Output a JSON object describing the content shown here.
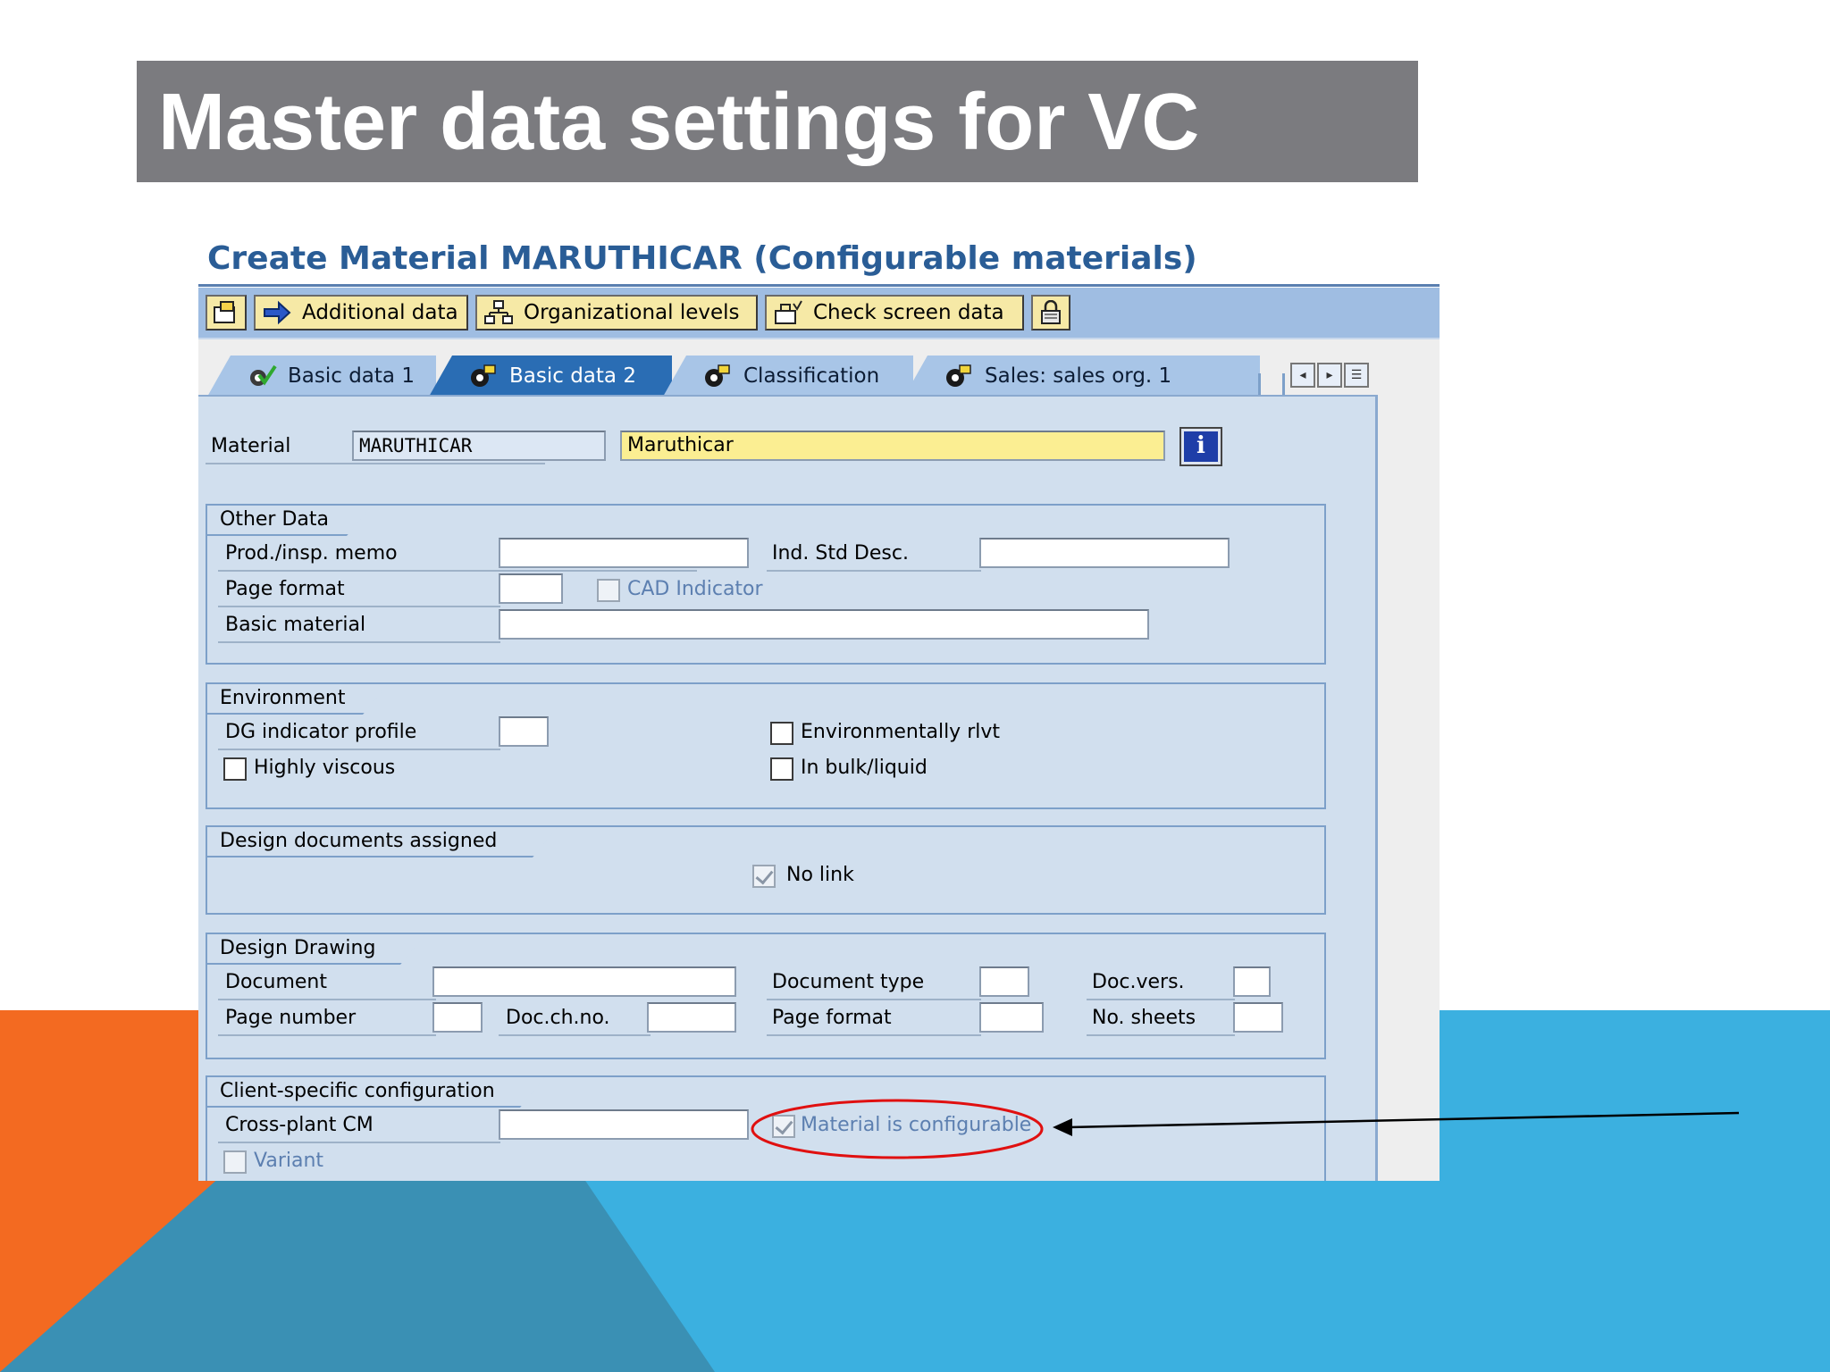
{
  "slide": {
    "title": "Master data settings for VC",
    "colors": {
      "title_bar": "#7b7b7f",
      "orange": "#f36a21",
      "blue": "#3bb0e0",
      "dark_blue": "#3a90b4"
    }
  },
  "sap": {
    "window_title": "Create Material MARUTHICAR (Configurable materials)",
    "toolbar": {
      "additional_data": "Additional data",
      "org_levels": "Organizational levels",
      "check_screen_data": "Check screen data"
    },
    "tabs": [
      {
        "label": "Basic data 1"
      },
      {
        "label": "Basic data 2"
      },
      {
        "label": "Classification"
      },
      {
        "label": "Sales: sales org. 1"
      }
    ],
    "material": {
      "label": "Material",
      "number": "MARUTHICAR",
      "description": "Maruthicar"
    },
    "other_data": {
      "title": "Other Data",
      "prod_insp_memo": "Prod./insp. memo",
      "ind_std_desc": "Ind. Std Desc.",
      "page_format": "Page format",
      "cad_indicator": "CAD Indicator",
      "basic_material": "Basic material"
    },
    "environment": {
      "title": "Environment",
      "dg_indicator_profile": "DG indicator profile",
      "environmentally_rlvt": "Environmentally rlvt",
      "highly_viscous": "Highly viscous",
      "in_bulk_liquid": "In bulk/liquid"
    },
    "design_documents": {
      "title": "Design documents assigned",
      "no_link": "No link"
    },
    "design_drawing": {
      "title": "Design Drawing",
      "document": "Document",
      "document_type": "Document type",
      "doc_vers": "Doc.vers.",
      "page_number": "Page number",
      "doc_ch_no": "Doc.ch.no.",
      "page_format": "Page format",
      "no_sheets": "No. sheets"
    },
    "client_config": {
      "title": "Client-specific configuration",
      "cross_plant_cm": "Cross-plant CM",
      "material_is_configurable": "Material is configurable",
      "variant": "Variant"
    }
  }
}
